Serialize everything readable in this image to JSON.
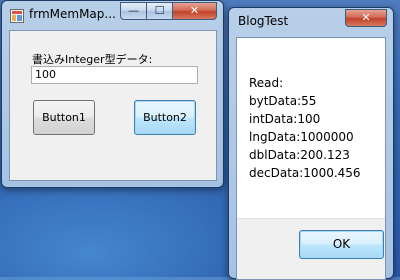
{
  "form1": {
    "title": "frmMemMap...",
    "caption": {
      "minimize": "—",
      "maximize": "☐",
      "close": "✕"
    },
    "label": "書込みInteger型データ:",
    "input_value": "100",
    "button1_label": "Button1",
    "button2_label": "Button2"
  },
  "blogtest": {
    "title": "BlogTest",
    "caption": {
      "close": "✕"
    },
    "lines": [
      "Read:",
      "bytData:55",
      "intData:100",
      "lngData:1000000",
      "dblData:200.123",
      "decData:1000.456"
    ],
    "ok_label": "OK"
  }
}
